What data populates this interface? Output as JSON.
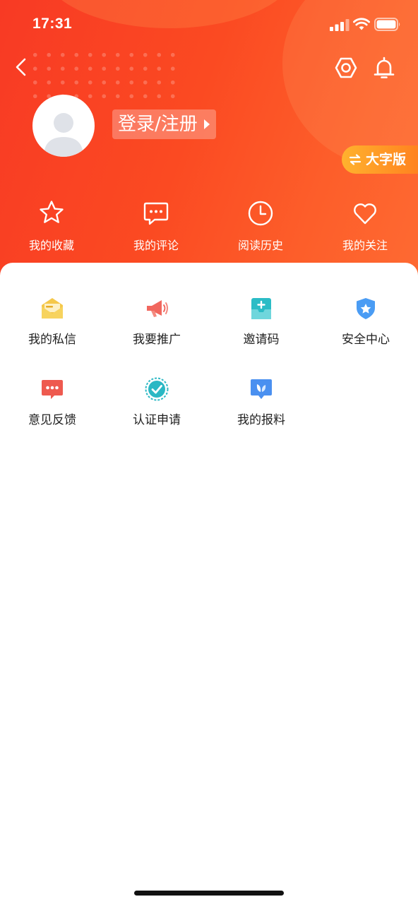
{
  "status_bar": {
    "time": "17:31"
  },
  "header": {
    "login_label": "登录/注册",
    "big_font_label": "大字版"
  },
  "quick_actions": [
    {
      "label": "我的收藏",
      "icon": "star-icon"
    },
    {
      "label": "我的评论",
      "icon": "comment-icon"
    },
    {
      "label": "阅读历史",
      "icon": "clock-icon"
    },
    {
      "label": "我的关注",
      "icon": "heart-icon"
    }
  ],
  "services": [
    {
      "label": "我的私信",
      "icon": "envelope-icon",
      "color": "#f5c84a"
    },
    {
      "label": "我要推广",
      "icon": "megaphone-icon",
      "color": "#f1675e"
    },
    {
      "label": "邀请码",
      "icon": "invite-code-icon",
      "color": "#2bbcc6"
    },
    {
      "label": "安全中心",
      "icon": "shield-icon",
      "color": "#4a9cf4"
    },
    {
      "label": "意见反馈",
      "icon": "feedback-icon",
      "color": "#ee5a4f"
    },
    {
      "label": "认证申请",
      "icon": "verified-icon",
      "color": "#2bb8c4"
    },
    {
      "label": "我的报料",
      "icon": "report-icon",
      "color": "#4a90f0"
    }
  ],
  "colors": {
    "header_start": "#f83a24",
    "header_end": "#fe6a32",
    "big_font_badge": "#ff9a26"
  }
}
